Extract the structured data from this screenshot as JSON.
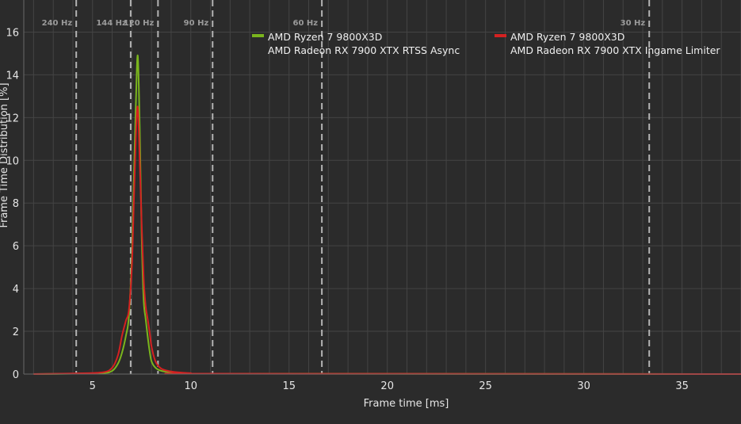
{
  "colors": {
    "background": "#2b2b2b",
    "plot_background": "#2b2b2b",
    "grid": "#444444",
    "refresh_line": "#b4b4b4",
    "text": "#e6e6e6"
  },
  "chart_data": {
    "type": "line",
    "title": "",
    "xlabel": "Frame time [ms]",
    "ylabel": "Frame Time Distribution [%]",
    "xlim": [
      1.5,
      38
    ],
    "ylim": [
      0,
      17.5
    ],
    "xticks": [
      5,
      10,
      15,
      20,
      25,
      30,
      35
    ],
    "yticks": [
      0,
      2,
      4,
      6,
      8,
      10,
      12,
      14,
      16
    ],
    "grid": true,
    "legend_position": "top",
    "refresh_lines": [
      {
        "label": "240 Hz",
        "x": 4.17
      },
      {
        "label": "144 Hz",
        "x": 6.94
      },
      {
        "label": "120 Hz",
        "x": 8.33
      },
      {
        "label": "90 Hz",
        "x": 11.11
      },
      {
        "label": "60 Hz",
        "x": 16.67
      },
      {
        "label": "30 Hz",
        "x": 33.33
      }
    ],
    "series": [
      {
        "name": "AMD Ryzen 7 9800X3D\nAMD Radeon RX 7900 XTX RTSS Async",
        "legend_line1": "AMD Ryzen 7 9800X3D",
        "legend_line2": "AMD Radeon RX 7900 XTX RTSS Async",
        "color": "#7ab51d",
        "x": [
          2.0,
          4.0,
          5.5,
          6.0,
          6.3,
          6.5,
          6.7,
          6.85,
          7.0,
          7.1,
          7.2,
          7.3,
          7.4,
          7.5,
          7.6,
          7.7,
          7.8,
          7.9,
          8.0,
          8.2,
          8.5,
          9.0,
          9.5,
          10.0,
          11.0,
          38.0
        ],
        "y": [
          0.0,
          0.02,
          0.05,
          0.15,
          0.5,
          1.0,
          1.8,
          2.7,
          5.5,
          9.0,
          12.5,
          14.9,
          11.5,
          6.5,
          3.5,
          2.6,
          1.8,
          1.1,
          0.6,
          0.3,
          0.15,
          0.08,
          0.05,
          0.03,
          0.02,
          0.0
        ]
      },
      {
        "name": "AMD Ryzen 7 9800X3D\nAMD Radeon RX 7900 XTX Ingame Limiter",
        "legend_line1": "AMD Ryzen 7 9800X3D",
        "legend_line2": "AMD Radeon RX 7900 XTX Ingame Limiter",
        "color": "#d42121",
        "x": [
          2.0,
          4.0,
          5.5,
          6.0,
          6.3,
          6.5,
          6.7,
          6.85,
          7.0,
          7.1,
          7.2,
          7.3,
          7.4,
          7.5,
          7.6,
          7.7,
          7.8,
          7.9,
          8.0,
          8.2,
          8.5,
          9.0,
          9.5,
          10.0,
          11.0,
          38.0
        ],
        "y": [
          0.0,
          0.03,
          0.08,
          0.3,
          0.9,
          1.8,
          2.5,
          3.0,
          5.0,
          8.0,
          11.0,
          12.5,
          10.0,
          7.0,
          4.5,
          3.2,
          2.6,
          2.0,
          1.3,
          0.6,
          0.25,
          0.12,
          0.07,
          0.04,
          0.02,
          0.0
        ]
      }
    ]
  }
}
